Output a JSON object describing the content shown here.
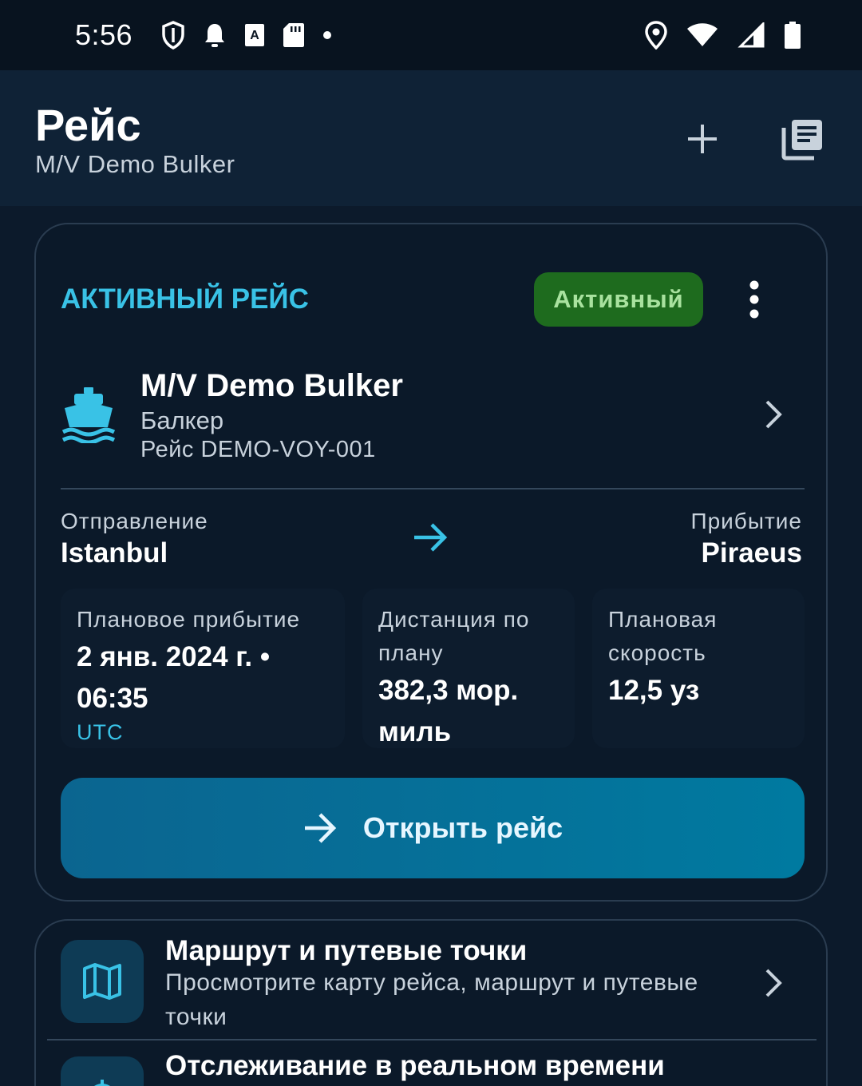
{
  "status_bar": {
    "time": "5:56"
  },
  "app_bar": {
    "title": "Рейс",
    "subtitle": "M/V Demo Bulker"
  },
  "active_voyage": {
    "section_label": "АКТИВНЫЙ РЕЙС",
    "status_badge": "Активный",
    "ship": {
      "name": "M/V Demo Bulker",
      "type": "Балкер",
      "voyage": "Рейс DEMO-VOY-001"
    },
    "departure": {
      "label": "Отправление",
      "value": "Istanbul"
    },
    "arrival": {
      "label": "Прибытие",
      "value": "Piraeus"
    },
    "stats": {
      "eta": {
        "label": "Плановое прибытие",
        "value": "2 янв. 2024 г. • 06:35",
        "unit": "UTC"
      },
      "distance": {
        "label": "Дистанция по плану",
        "value": "382,3 мор. миль"
      },
      "speed": {
        "label": "Плановая скорость",
        "value": "12,5 уз"
      }
    },
    "open_button": "Открыть рейс"
  },
  "list": [
    {
      "title": "Маршрут и путевые точки",
      "description": "Просмотрите карту рейса, маршрут и путевые точки",
      "icon": "map-icon"
    },
    {
      "title": "Отслеживание в реальном времени",
      "icon": "tracking-icon"
    }
  ],
  "colors": {
    "accent": "#39c2e6",
    "badge_bg": "#1e6b1e",
    "badge_text": "#a9e29f",
    "button_bg": "#0077a0",
    "background": "#0c1a2b"
  }
}
